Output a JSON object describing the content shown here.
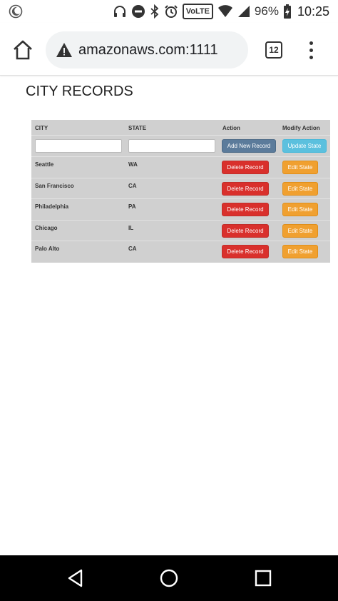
{
  "status_bar": {
    "volte": "VoLTE",
    "battery": "96%",
    "time": "10:25"
  },
  "browser": {
    "url": "amazonaws.com:1111",
    "tab_count": "12"
  },
  "page": {
    "title": "CITY RECORDS"
  },
  "table": {
    "headers": {
      "city": "CITY",
      "state": "STATE",
      "action": "Action",
      "modify": "Modify Action"
    },
    "add_button": "Add New Record",
    "update_button": "Update State",
    "city_input_value": "",
    "state_input_value": "",
    "rows": [
      {
        "city": "Seattle",
        "state": "WA",
        "delete": "Delete Record",
        "edit": "Edit State"
      },
      {
        "city": "San Francisco",
        "state": "CA",
        "delete": "Delete Record",
        "edit": "Edit State"
      },
      {
        "city": "Philadelphia",
        "state": "PA",
        "delete": "Delete Record",
        "edit": "Edit State"
      },
      {
        "city": "Chicago",
        "state": "IL",
        "delete": "Delete Record",
        "edit": "Edit State"
      },
      {
        "city": "Palo Alto",
        "state": "CA",
        "delete": "Delete Record",
        "edit": "Edit State"
      }
    ]
  },
  "icons": {
    "status_left": "moon-icon",
    "headphones": "headphones-icon",
    "dnd": "do-not-disturb-icon",
    "bluetooth": "bluetooth-icon",
    "alarm": "alarm-icon",
    "wifi": "wifi-icon",
    "signal": "signal-icon",
    "battery": "battery-charging-icon",
    "home": "home-icon",
    "warning": "warning-icon",
    "menu": "more-vert-icon",
    "back": "nav-back-icon",
    "nav_home": "nav-home-icon",
    "recents": "nav-recents-icon"
  }
}
